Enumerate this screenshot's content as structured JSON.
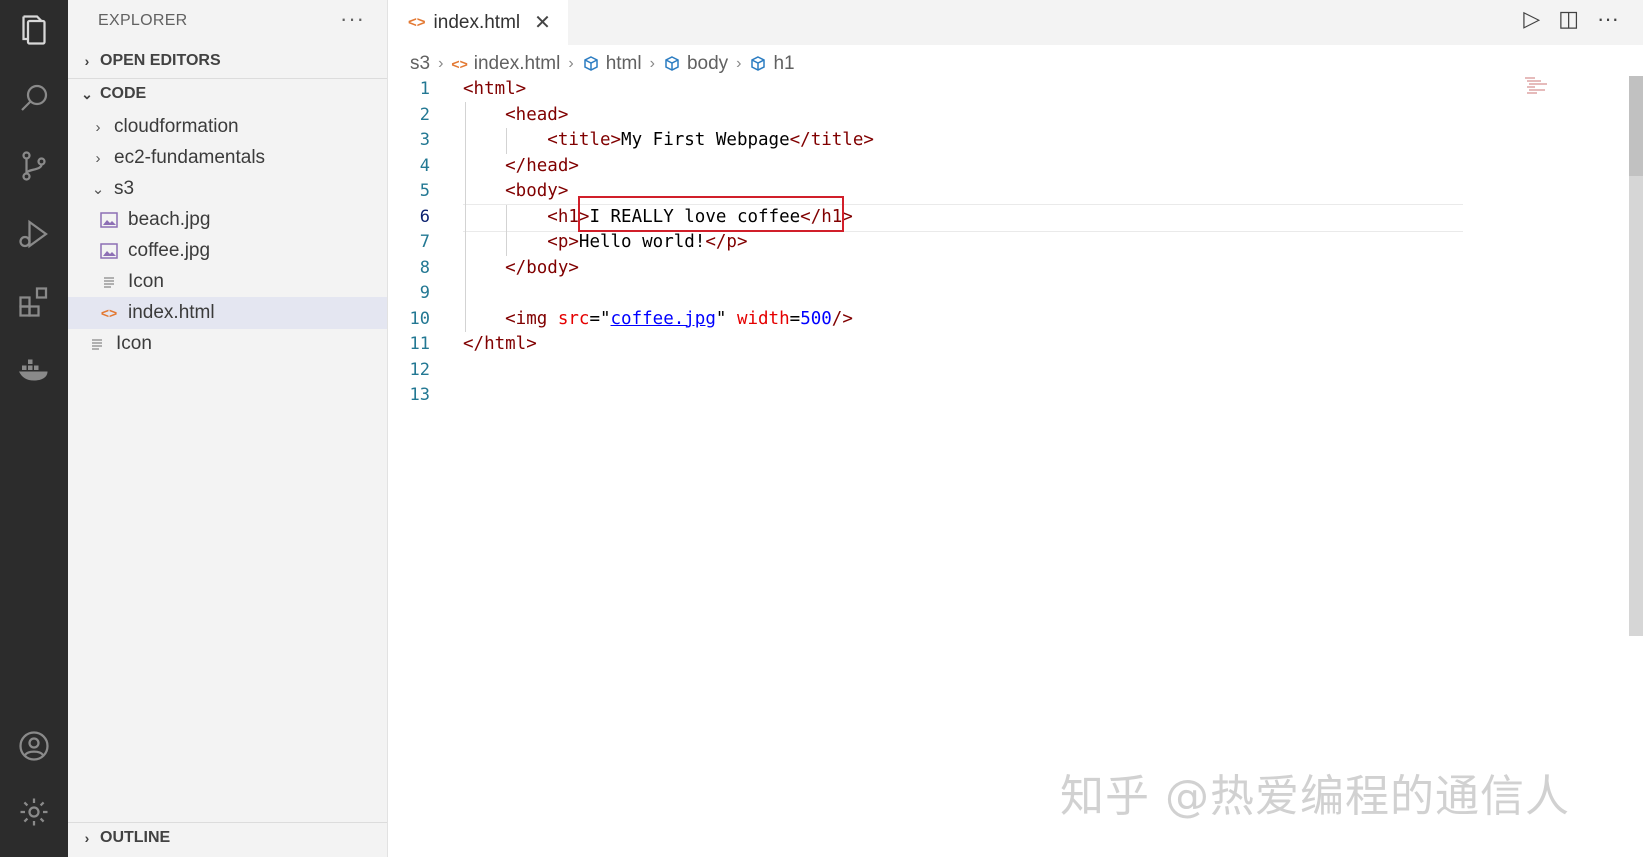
{
  "explorer": {
    "title": "EXPLORER",
    "more": "···",
    "open_editors": "OPEN EDITORS",
    "workspace": "CODE",
    "tree": [
      {
        "label": "cloudformation",
        "kind": "folder",
        "expanded": false
      },
      {
        "label": "ec2-fundamentals",
        "kind": "folder",
        "expanded": false
      },
      {
        "label": "s3",
        "kind": "folder",
        "expanded": true
      },
      {
        "label": "beach.jpg",
        "kind": "image"
      },
      {
        "label": "coffee.jpg",
        "kind": "image"
      },
      {
        "label": "Icon",
        "kind": "text"
      },
      {
        "label": "index.html",
        "kind": "html",
        "selected": true
      },
      {
        "label": "Icon",
        "kind": "text"
      }
    ],
    "outline": "OUTLINE"
  },
  "tab": {
    "label": "index.html",
    "close": "✕",
    "code_glyph": "<>"
  },
  "breadcrumb": [
    "s3",
    "index.html",
    "html",
    "body",
    "h1"
  ],
  "code": {
    "lines": [
      {
        "n": "1",
        "parts": [
          [
            "tag",
            "<html>"
          ]
        ]
      },
      {
        "n": "2",
        "parts": [
          [
            "tag",
            "    <head>"
          ]
        ]
      },
      {
        "n": "3",
        "parts": [
          [
            "tag",
            "        <title>"
          ],
          [
            "plain",
            "My First Webpage"
          ],
          [
            "tag",
            "</title>"
          ]
        ]
      },
      {
        "n": "4",
        "parts": [
          [
            "tag",
            "    </head>"
          ]
        ]
      },
      {
        "n": "5",
        "parts": [
          [
            "tag",
            "    <body>"
          ]
        ]
      },
      {
        "n": "6",
        "parts": [
          [
            "tag",
            "        <h1>"
          ],
          [
            "plain",
            "I REALLY love coffee"
          ],
          [
            "tag",
            "</h1>"
          ]
        ]
      },
      {
        "n": "7",
        "parts": [
          [
            "tag",
            "        <p>"
          ],
          [
            "plain",
            "Hello world!"
          ],
          [
            "tag",
            "</p>"
          ]
        ]
      },
      {
        "n": "8",
        "parts": [
          [
            "tag",
            "    </body>"
          ]
        ]
      },
      {
        "n": "9",
        "parts": []
      },
      {
        "n": "10",
        "parts": [
          [
            "tag",
            "    <img "
          ],
          [
            "attr",
            "src"
          ],
          [
            "plain",
            "=\""
          ],
          [
            "link",
            "coffee.jpg"
          ],
          [
            "plain",
            "\" "
          ],
          [
            "attr",
            "width"
          ],
          [
            "plain",
            "="
          ],
          [
            "val",
            "500"
          ],
          [
            "tag",
            "/>"
          ]
        ]
      },
      {
        "n": "11",
        "parts": [
          [
            "tag",
            "</html>"
          ]
        ]
      },
      {
        "n": "12",
        "parts": []
      },
      {
        "n": "13",
        "parts": []
      }
    ],
    "active_line": "6"
  },
  "watermark": "知乎 @热爱编程的通信人",
  "colors": {
    "activity_bar": "#2c2c2c",
    "sidebar": "#f3f3f3",
    "tag": "#800000",
    "attr": "#e50000",
    "value": "#0000ff",
    "highlight_box": "#d11f2a"
  }
}
